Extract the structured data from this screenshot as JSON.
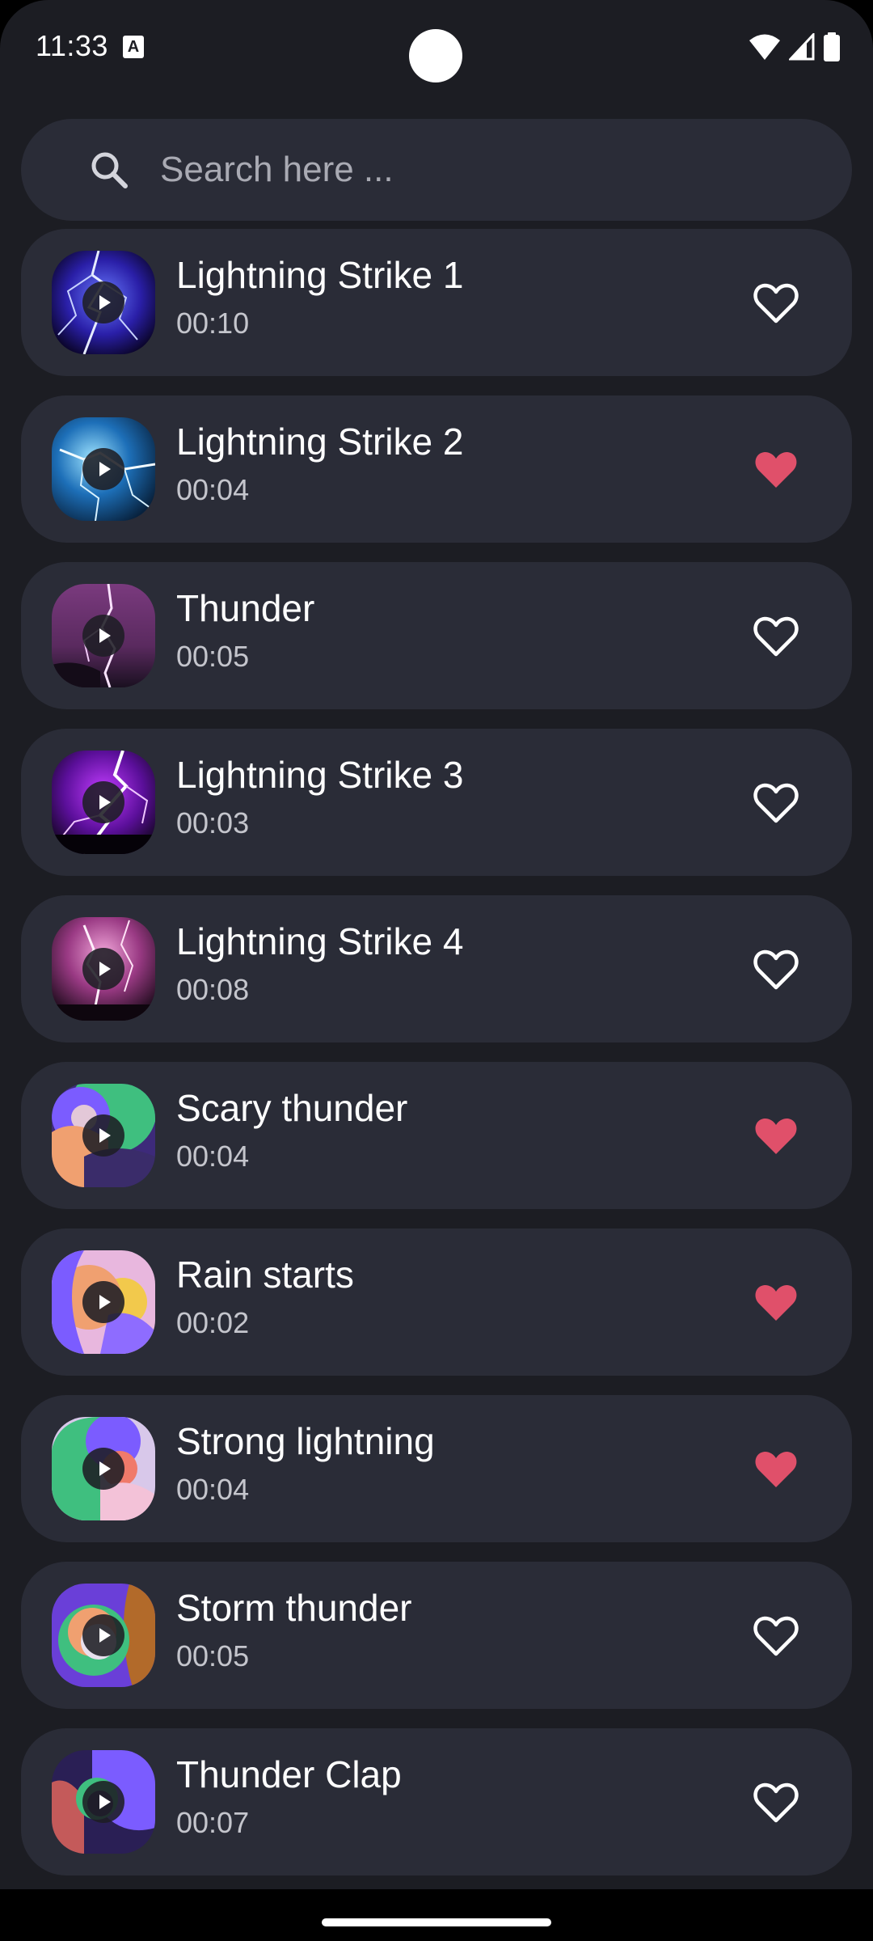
{
  "status_bar": {
    "time": "11:33",
    "notification_icon": "a-icon",
    "icons": [
      "wifi-icon",
      "signal-icon",
      "battery-icon"
    ]
  },
  "search": {
    "placeholder": "Search here ...",
    "icon": "search-icon"
  },
  "colors": {
    "background": "#1c1d23",
    "card": "#2a2c37",
    "favorite_active": "#e0506a",
    "text_primary": "#ffffff",
    "text_secondary": "#c4c5cc"
  },
  "sounds": [
    {
      "title": "Lightning Strike 1",
      "duration": "00:10",
      "favorite": false,
      "art": "lightning-blue"
    },
    {
      "title": "Lightning Strike 2",
      "duration": "00:04",
      "favorite": true,
      "art": "lightning-cyan"
    },
    {
      "title": "Thunder",
      "duration": "00:05",
      "favorite": false,
      "art": "lightning-pink"
    },
    {
      "title": "Lightning Strike 3",
      "duration": "00:03",
      "favorite": false,
      "art": "lightning-purple"
    },
    {
      "title": "Lightning Strike 4",
      "duration": "00:08",
      "favorite": false,
      "art": "lightning-magenta"
    },
    {
      "title": "Scary thunder",
      "duration": "00:04",
      "favorite": true,
      "art": "abstract-1"
    },
    {
      "title": "Rain starts",
      "duration": "00:02",
      "favorite": true,
      "art": "abstract-2"
    },
    {
      "title": "Strong lightning",
      "duration": "00:04",
      "favorite": true,
      "art": "abstract-3"
    },
    {
      "title": "Storm thunder",
      "duration": "00:05",
      "favorite": false,
      "art": "abstract-4"
    },
    {
      "title": "Thunder Clap",
      "duration": "00:07",
      "favorite": false,
      "art": "abstract-5"
    }
  ]
}
